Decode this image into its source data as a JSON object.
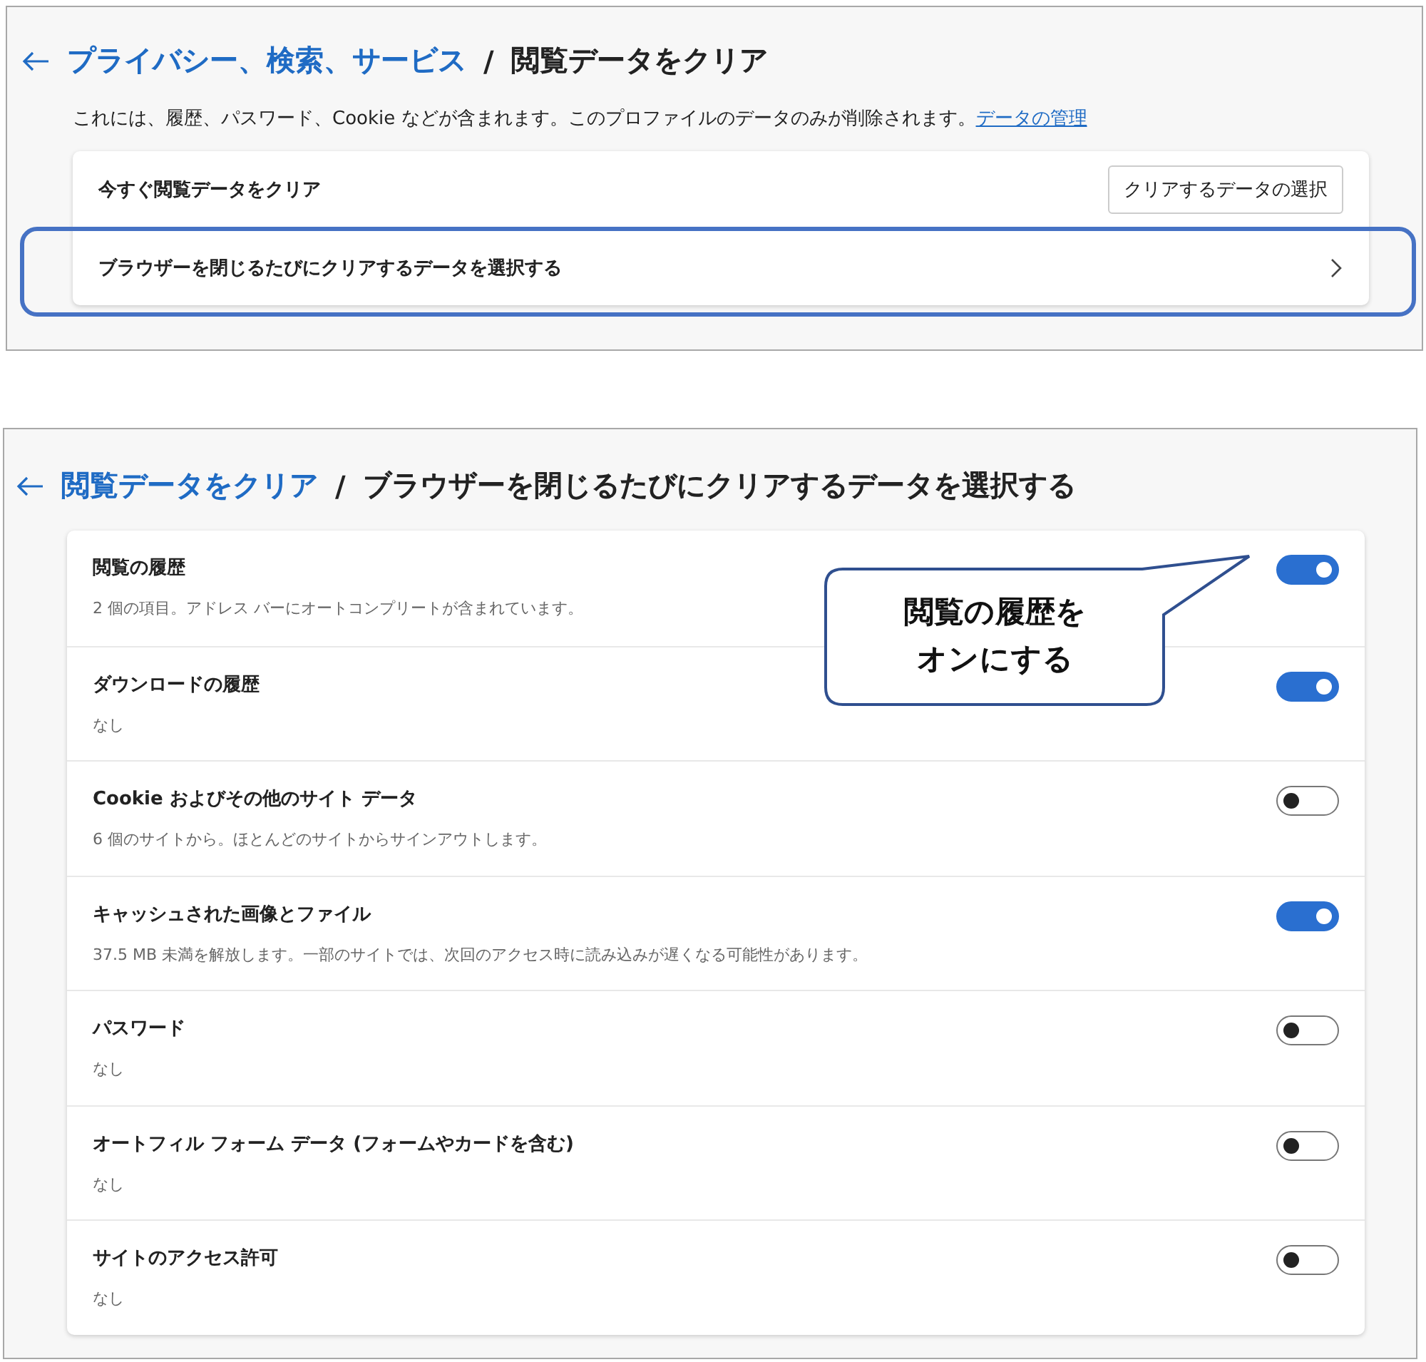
{
  "clear_panel": {
    "breadcrumb_link": "プライバシー、検索、サービス",
    "separator": "/",
    "title": "閲覧データをクリア",
    "description": "これには、履歴、パスワード、Cookie などが含まれます。このプロファイルのデータのみが削除されます。",
    "description_link": "データの管理",
    "rows": [
      {
        "kind": "button",
        "label": "今すぐ閲覧データをクリア",
        "button": "クリアするデータの選択",
        "highlighted": false
      },
      {
        "kind": "chevron",
        "label": "ブラウザーを閉じるたびにクリアするデータを選択する",
        "highlighted": true
      }
    ]
  },
  "close_panel": {
    "breadcrumb_link": "閲覧データをクリア",
    "separator": "/",
    "title": "ブラウザーを閉じるたびにクリアするデータを選択する",
    "items": [
      {
        "label": "閲覧の履歴",
        "detail": "2 個の項目。アドレス バーにオートコンプリートが含まれています。",
        "on": true
      },
      {
        "label": "ダウンロードの履歴",
        "detail": "なし",
        "on": true
      },
      {
        "label": "Cookie およびその他のサイト データ",
        "detail": "6 個のサイトから。ほとんどのサイトからサインアウトします。",
        "on": false
      },
      {
        "label": "キャッシュされた画像とファイル",
        "detail": "37.5 MB 未満を解放します。一部のサイトでは、次回のアクセス時に読み込みが遅くなる可能性があります。",
        "on": true
      },
      {
        "label": "パスワード",
        "detail": "なし",
        "on": false
      },
      {
        "label": "オートフィル フォーム データ (フォームやカードを含む)",
        "detail": "なし",
        "on": false
      },
      {
        "label": "サイトのアクセス許可",
        "detail": "なし",
        "on": false
      }
    ]
  },
  "callout": {
    "lines": [
      "閲覧の履歴を",
      "オンにする"
    ]
  }
}
